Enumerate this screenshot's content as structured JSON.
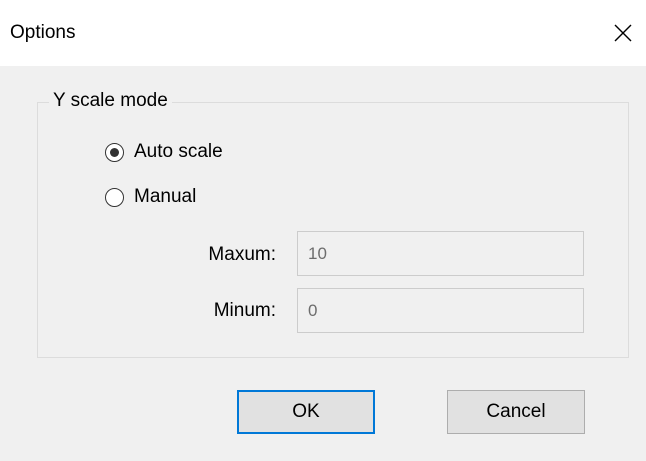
{
  "window": {
    "title": "Options",
    "close_icon": "close-icon"
  },
  "group": {
    "title": "Y scale mode"
  },
  "radios": {
    "auto_label": "Auto scale",
    "auto_selected": true,
    "manual_label": "Manual",
    "manual_selected": false
  },
  "fields": {
    "maximum_label": "Maxum:",
    "maximum_value": "10",
    "minimum_label": "Minum:",
    "minimum_value": "0"
  },
  "buttons": {
    "ok_label": "OK",
    "cancel_label": "Cancel"
  },
  "colors": {
    "background": "#f0f0f0",
    "titlebar": "#ffffff",
    "accent": "#0078d7",
    "disabled_text": "#6d6d6d"
  }
}
